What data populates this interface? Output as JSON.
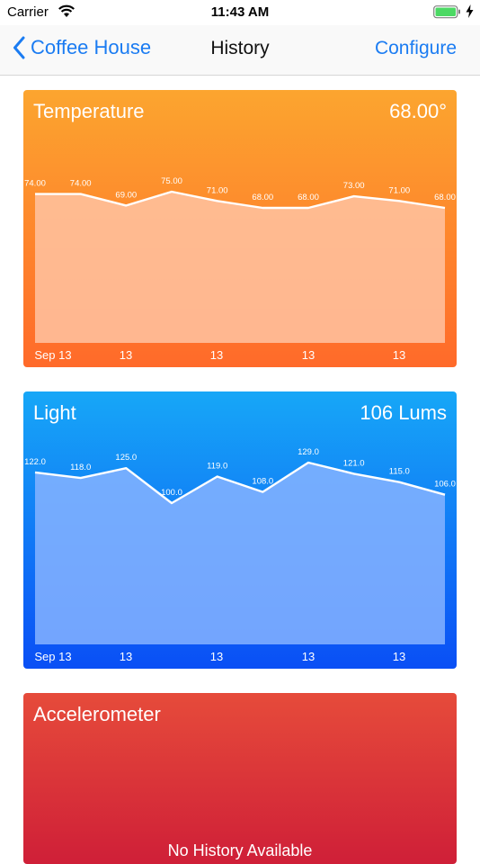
{
  "status_bar": {
    "carrier": "Carrier",
    "time": "11:43 AM",
    "icons": [
      "wifi-icon",
      "battery-icon",
      "charge-icon"
    ]
  },
  "nav": {
    "back_label": "Coffee House",
    "title": "History",
    "configure_label": "Configure",
    "tint": "#1b7cf2"
  },
  "cards": {
    "temperature": {
      "title": "Temperature",
      "value": "68.00°",
      "colors": [
        "#fca52f",
        "#ff6a2a"
      ]
    },
    "light": {
      "title": "Light",
      "value": "106 Lums",
      "colors": [
        "#17a7f7",
        "#0a4ff5"
      ]
    },
    "accelerometer": {
      "title": "Accelerometer",
      "message": "No History Available",
      "colors": [
        "#e64b3a",
        "#cf1f38"
      ]
    }
  },
  "chart_data": [
    {
      "type": "area",
      "title": "Temperature",
      "values": [
        74.0,
        74.0,
        69.0,
        75.0,
        71.0,
        68.0,
        68.0,
        73.0,
        71.0,
        68.0
      ],
      "value_labels": [
        "74.00",
        "74.00",
        "69.00",
        "75.00",
        "71.00",
        "68.00",
        "68.00",
        "73.00",
        "71.00",
        "68.00"
      ],
      "x_tick_labels": [
        "Sep 13",
        "13",
        "13",
        "13",
        "13"
      ],
      "fill": "#ffc3a2",
      "line": "#ffffff"
    },
    {
      "type": "area",
      "title": "Light",
      "values": [
        122.0,
        118.0,
        125.0,
        100.0,
        119.0,
        108.0,
        129.0,
        121.0,
        115.0,
        106.0
      ],
      "value_labels": [
        "122.0",
        "118.0",
        "125.0",
        "100.0",
        "119.0",
        "108.0",
        "129.0",
        "121.0",
        "115.0",
        "106.0"
      ],
      "x_tick_labels": [
        "Sep 13",
        "13",
        "13",
        "13",
        "13"
      ],
      "fill": "#86b3ff",
      "line": "#ffffff"
    }
  ]
}
